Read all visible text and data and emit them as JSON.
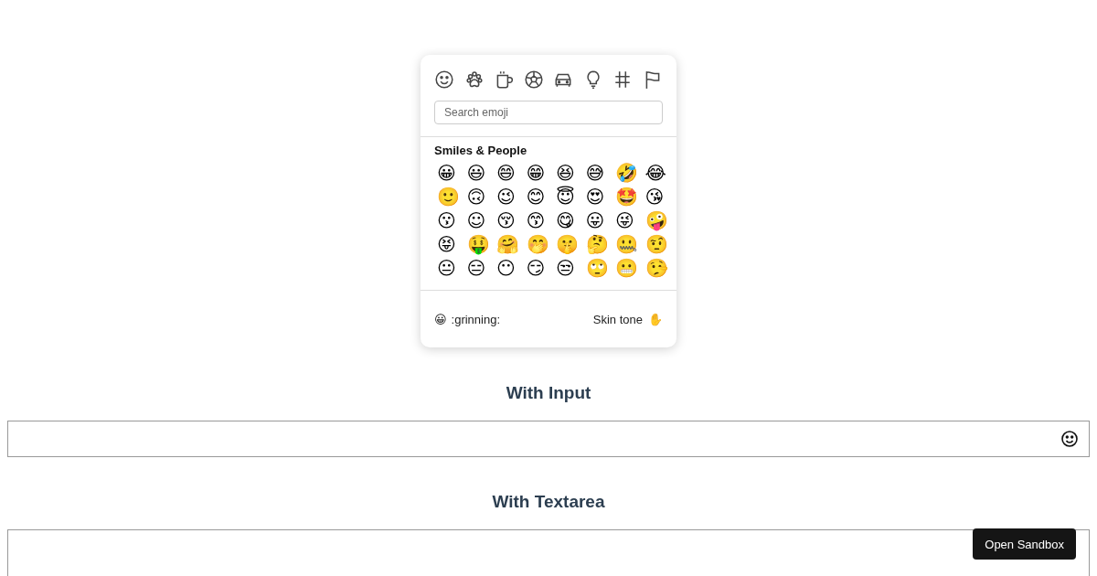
{
  "picker": {
    "categories": [
      {
        "kind": "smiley"
      },
      {
        "kind": "paw"
      },
      {
        "kind": "cup"
      },
      {
        "kind": "ball"
      },
      {
        "kind": "car"
      },
      {
        "kind": "bulb"
      },
      {
        "kind": "hash"
      },
      {
        "kind": "flag"
      }
    ],
    "search": {
      "placeholder": "Search emoji"
    },
    "section_title": "Smiles & People",
    "emojis": [
      "😀",
      "😃",
      "😄",
      "😁",
      "😆",
      "😅",
      "🤣",
      "😂",
      "🙂",
      "🙃",
      "😉",
      "😊",
      "😇",
      "😍",
      "🤩",
      "😘",
      "😗",
      "☺",
      "😚",
      "😙",
      "😋",
      "😛",
      "😜",
      "🤪",
      "😝",
      "🤑",
      "🤗",
      "🤭",
      "🤫",
      "🤔",
      "🤐",
      "🤨",
      "😐",
      "😑",
      "😶",
      "😏",
      "😒",
      "🙄",
      "😬",
      "🤥"
    ],
    "preview": {
      "emoji": "😀",
      "name": ":grinning:"
    },
    "skin_tone": {
      "label": "Skin tone",
      "emoji": "✋"
    }
  },
  "sections": [
    {
      "title": "With Input",
      "kind": "input"
    },
    {
      "title": "With Textarea",
      "kind": "textarea"
    }
  ],
  "sandbox_button": "Open Sandbox"
}
